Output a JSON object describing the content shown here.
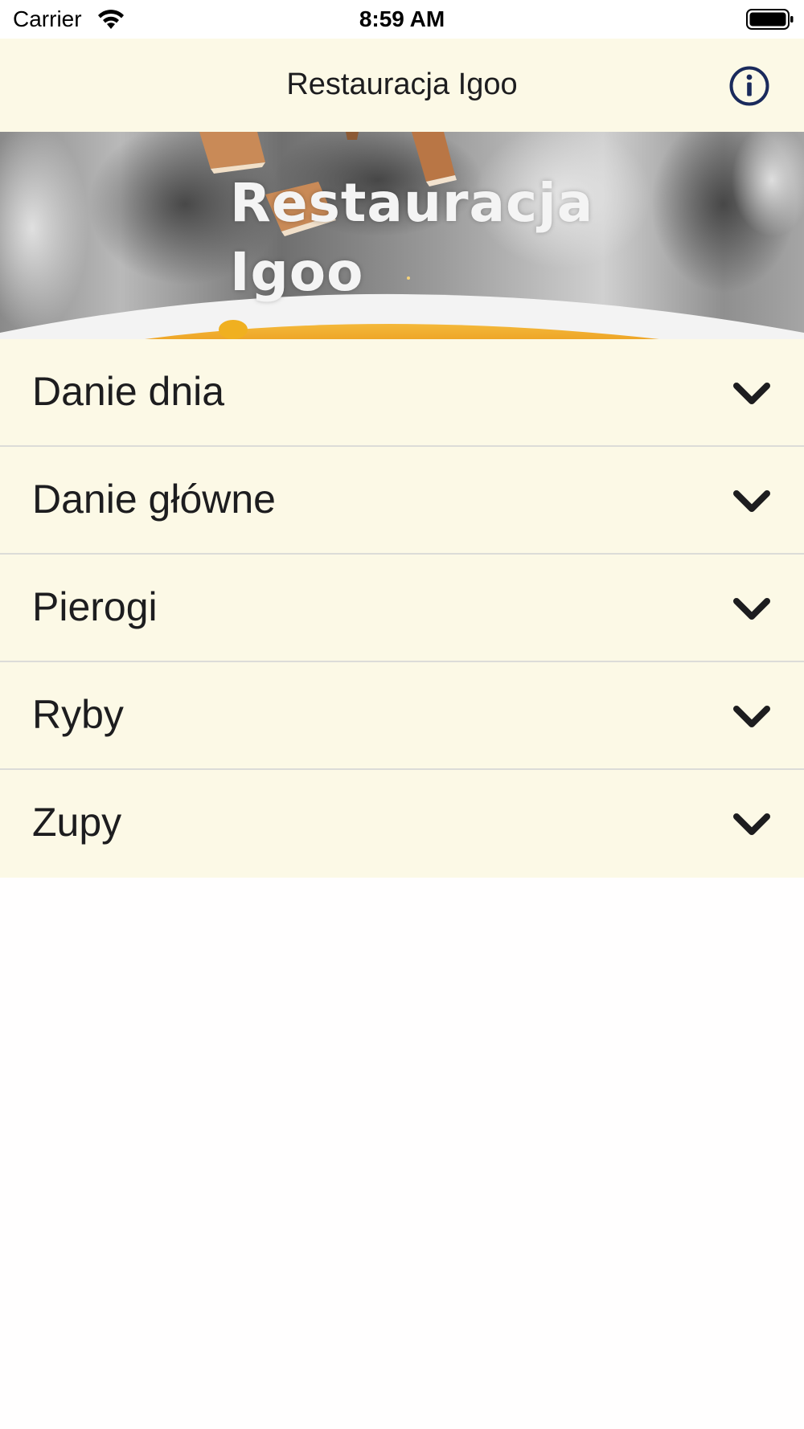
{
  "status_bar": {
    "carrier": "Carrier",
    "time": "8:59 AM"
  },
  "nav": {
    "title": "Restauracja Igoo",
    "info_icon": "info-circle-icon",
    "accent_color": "#1a2a5c"
  },
  "hero": {
    "line1": "Restauracja",
    "line2": "Igoo"
  },
  "menu": {
    "items": [
      {
        "label": "Danie dnia",
        "icon": "chevron-down-icon"
      },
      {
        "label": "Danie główne",
        "icon": "chevron-down-icon"
      },
      {
        "label": "Pierogi",
        "icon": "chevron-down-icon"
      },
      {
        "label": "Ryby",
        "icon": "chevron-down-icon"
      },
      {
        "label": "Zupy",
        "icon": "chevron-down-icon"
      }
    ]
  },
  "colors": {
    "nav_background": "#fcf9e6",
    "list_background": "#fcf9e6",
    "page_background": "#fffefe"
  }
}
